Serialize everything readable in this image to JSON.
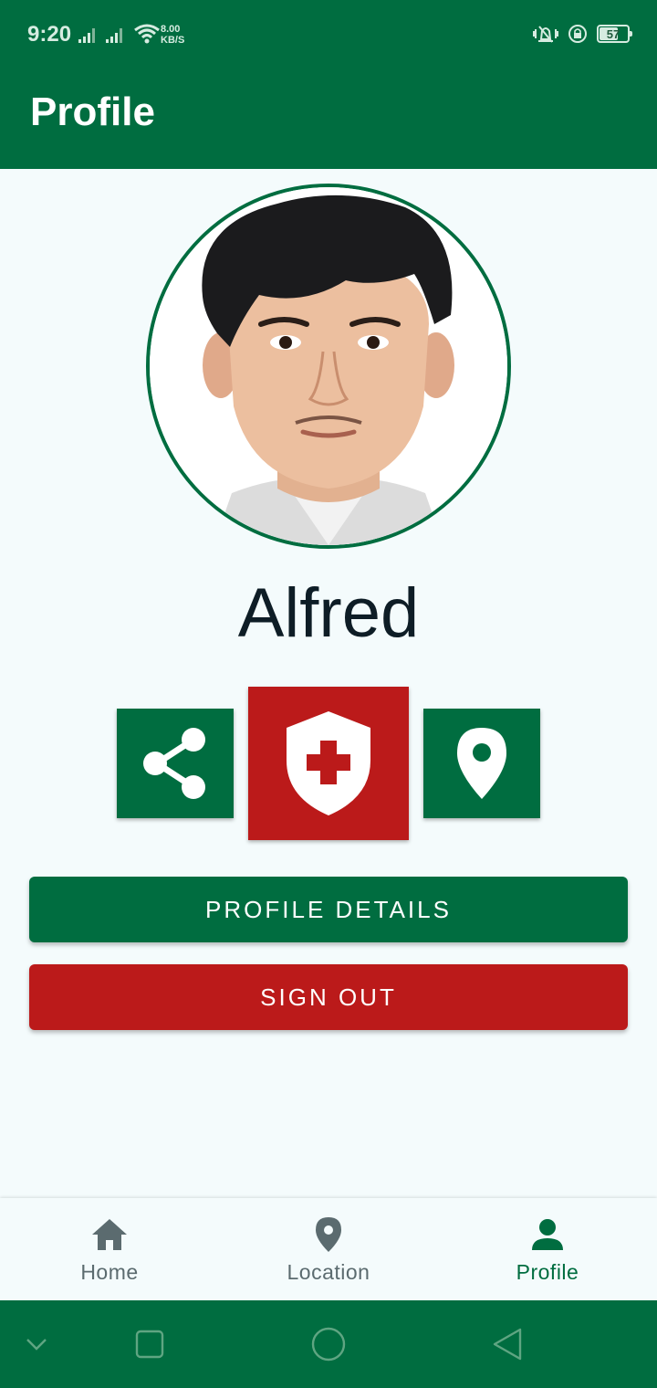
{
  "status_bar": {
    "time": "9:20",
    "net_speed_value": "8.00",
    "net_speed_unit": "KB/S",
    "battery_level": "57"
  },
  "app_bar": {
    "title": "Profile"
  },
  "profile": {
    "name": "Alfred"
  },
  "actions": {
    "share_icon": "share-icon",
    "emergency_icon": "shield-medical-icon",
    "location_icon": "location-pin-icon"
  },
  "buttons": {
    "profile_details": "PROFILE DETAILS",
    "sign_out": "SIGN OUT"
  },
  "bottom_nav": {
    "items": [
      {
        "label": "Home",
        "icon": "home-icon"
      },
      {
        "label": "Location",
        "icon": "location-pin-icon"
      },
      {
        "label": "Profile",
        "icon": "person-icon"
      }
    ],
    "active": "Profile"
  },
  "colors": {
    "primary_green": "#006d40",
    "emergency_red": "#bb1a1a",
    "background": "#f4fbfc",
    "inactive_nav": "#5b6b6f"
  }
}
